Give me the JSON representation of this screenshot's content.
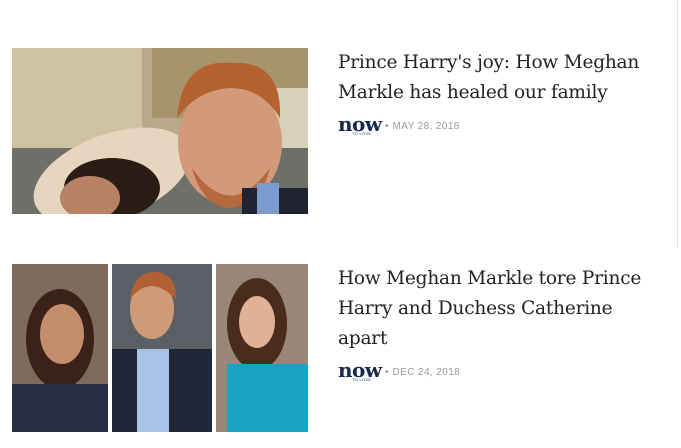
{
  "articles": [
    {
      "title": "Prince Harry's joy: How Meghan Markle has healed our family",
      "source_logo": "now",
      "source_logo_sub": "TO LOVE",
      "separator": "•",
      "date": "MAY 28, 2018"
    },
    {
      "title": "How Meghan Markle tore Prince Harry and Duchess Catherine apart",
      "source_logo": "now",
      "source_logo_sub": "TO LOVE",
      "separator": "•",
      "date": "DEC 24, 2018"
    }
  ],
  "colors": {
    "title_text": "#222222",
    "logo": "#16294d",
    "date_text": "#9a9a9a"
  }
}
